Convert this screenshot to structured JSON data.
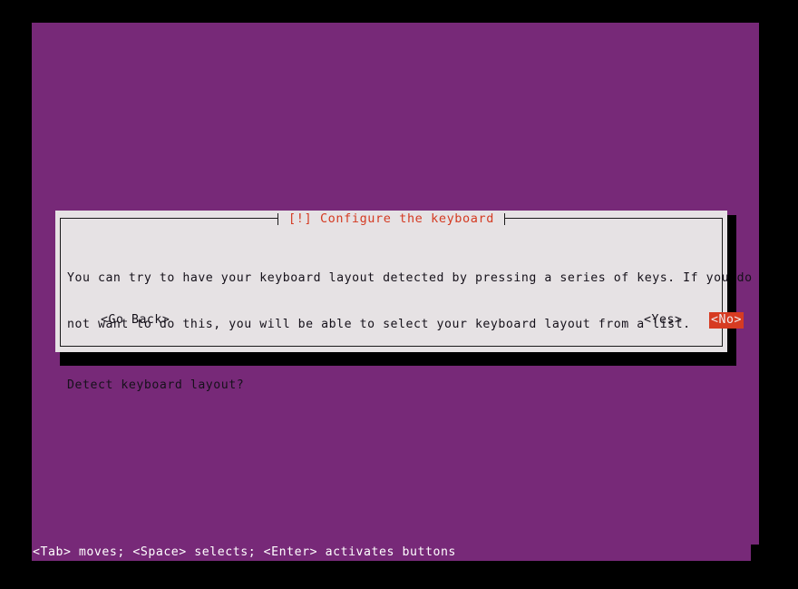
{
  "colors": {
    "terminal_background": "#772978",
    "dialog_background": "#e6e2e4",
    "dialog_border": "#1a1a1a",
    "title_accent": "#d43a22",
    "selected_button_background": "#d63b22",
    "selected_button_text": "#f0eaec",
    "body_text": "#15111a",
    "helpbar_text": "#ffffff",
    "shadow": "#000000",
    "screen_background": "#000000"
  },
  "dialog": {
    "title": "[!] Configure the keyboard",
    "paragraph": {
      "line1": "You can try to have your keyboard layout detected by pressing a series of keys. If you do",
      "line2": "not want to do this, you will be able to select your keyboard layout from a list."
    },
    "question": "Detect keyboard layout?",
    "buttons": [
      {
        "label": "<Go Back>",
        "selected": false
      },
      {
        "label": "<Yes>",
        "selected": false
      },
      {
        "label": "<No>",
        "selected": true
      }
    ]
  },
  "helpbar": {
    "text": "<Tab> moves; <Space> selects; <Enter> activates buttons"
  }
}
